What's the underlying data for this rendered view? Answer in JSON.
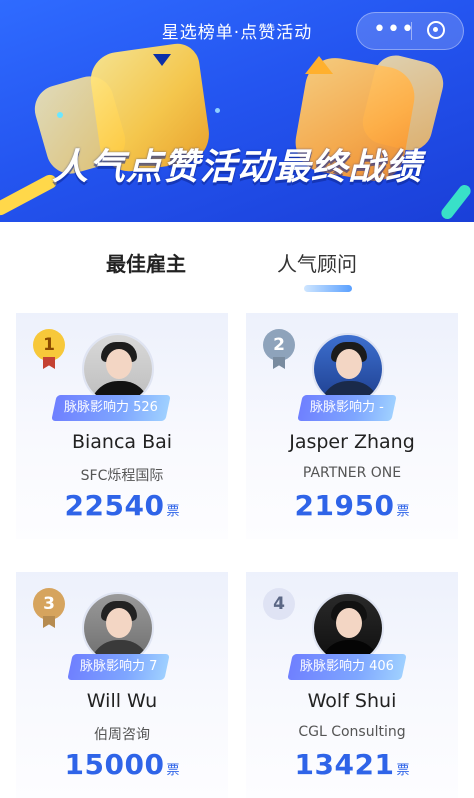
{
  "header": {
    "nav_title": "星选榜单·点赞活动",
    "more_icon": "more-dots-icon",
    "target_icon": "target-icon",
    "hero_title": "人气点赞活动最终战绩"
  },
  "tabs": [
    {
      "label": "最佳雇主",
      "active": false
    },
    {
      "label": "人气顾问",
      "active": true
    }
  ],
  "cards": [
    {
      "rank": "1",
      "badge": "脉脉影响力 526",
      "name": "Bianca Bai",
      "company": "SFC烁程国际",
      "votes": "22540",
      "votes_unit": "票"
    },
    {
      "rank": "2",
      "badge": "脉脉影响力 -",
      "name": "Jasper Zhang",
      "company": "PARTNER ONE",
      "votes": "21950",
      "votes_unit": "票"
    },
    {
      "rank": "3",
      "badge": "脉脉影响力 7",
      "name": "Will Wu",
      "company": "伯周咨询",
      "votes": "15000",
      "votes_unit": "票"
    },
    {
      "rank": "4",
      "badge": "脉脉影响力 406",
      "name": "Wolf Shui",
      "company": "CGL Consulting",
      "votes": "13421",
      "votes_unit": "票"
    }
  ],
  "colors": {
    "banner": "#2455f0",
    "votes": "#2f64e8",
    "badge": "#7ea6ff"
  }
}
